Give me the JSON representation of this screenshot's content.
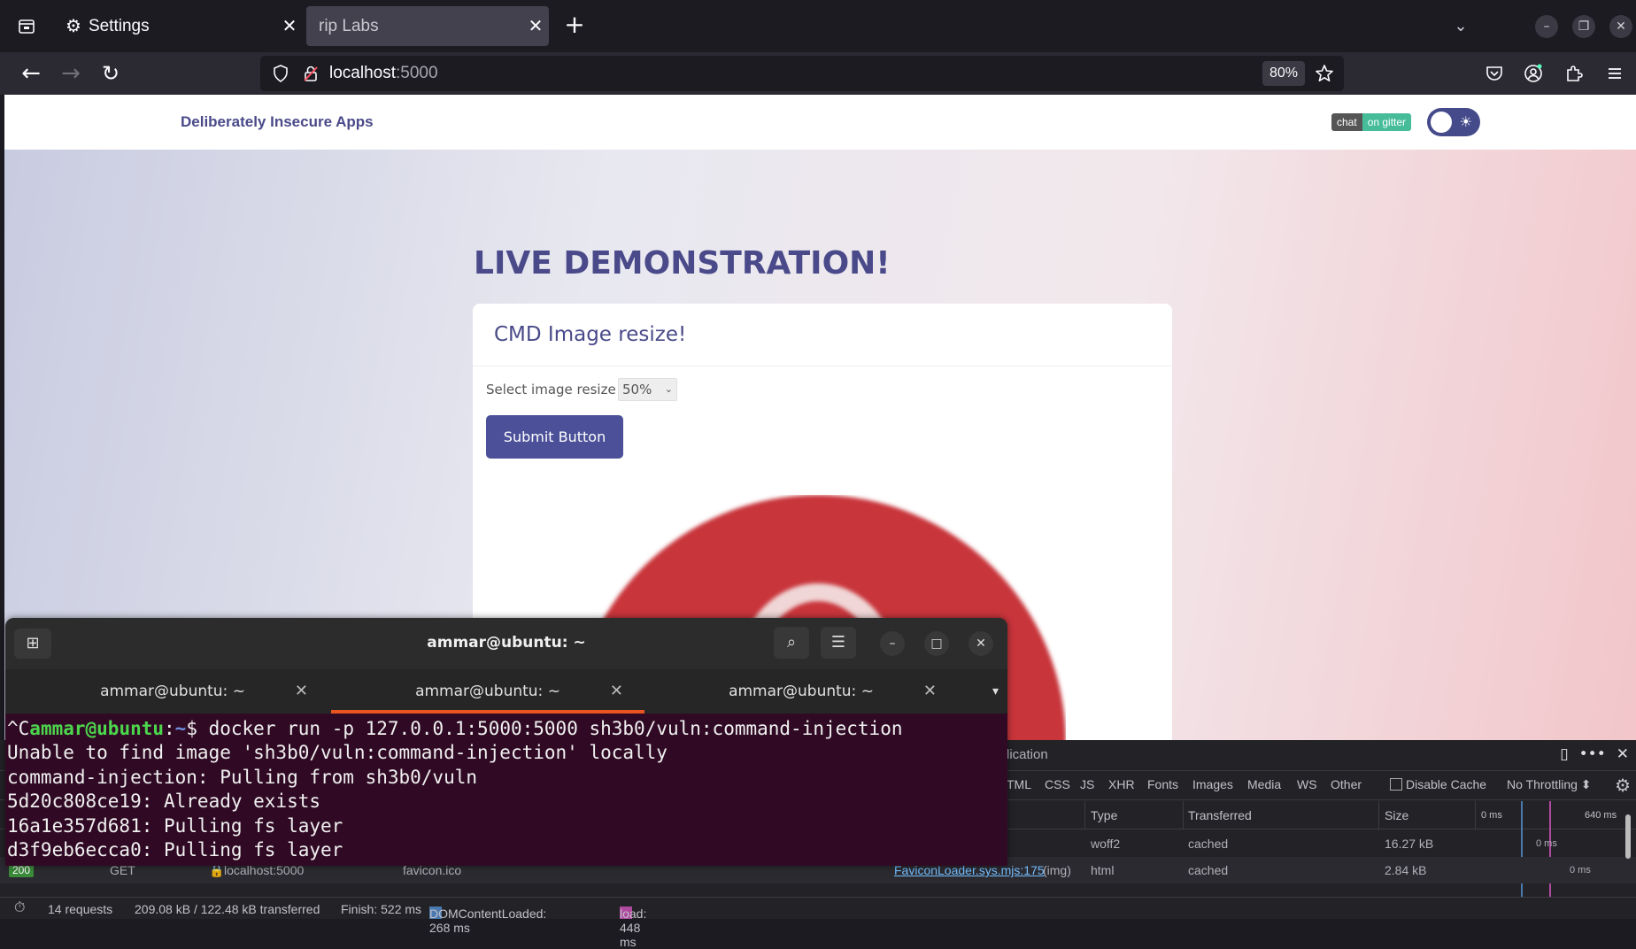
{
  "browser": {
    "tabs": [
      {
        "title": "Settings",
        "icon": "gear-icon"
      },
      {
        "title": "rip Labs",
        "icon": ""
      }
    ],
    "url_host": "localhost",
    "url_port": ":5000",
    "zoom": "80%"
  },
  "site": {
    "brand": "Deliberately Insecure Apps",
    "gitter_left": "chat",
    "gitter_right": "on gitter",
    "hero_title": "LIVE DEMONSTRATION!",
    "card_title": "CMD Image resize!",
    "resize_label": "Select image resize",
    "resize_value": "50%",
    "submit_label": "Submit Button",
    "logo_color": "#c8343a"
  },
  "devtools": {
    "panel_label": "lication",
    "filters": [
      "TML",
      "CSS",
      "JS",
      "XHR",
      "Fonts",
      "Images",
      "Media",
      "WS",
      "Other"
    ],
    "disable_cache": "Disable Cache",
    "throttling": "No Throttling ⬍",
    "columns": [
      "Type",
      "Transferred",
      "Size",
      "0 ms",
      "640 ms"
    ],
    "rows": [
      {
        "status": "",
        "method": "",
        "domain": "",
        "file": "",
        "initiator": "",
        "type": "woff2",
        "transferred": "cached",
        "size": "16.27 kB",
        "time": "0 ms"
      },
      {
        "status": "200",
        "method": "GET",
        "domain": "localhost:5000",
        "file": "favicon.ico",
        "initiator": "FaviconLoader.sys.mjs:175",
        "initiator_suffix": "(img)",
        "type": "html",
        "transferred": "cached",
        "size": "2.84 kB",
        "time": "0 ms"
      }
    ],
    "status": {
      "requests": "14 requests",
      "transferred": "209.08 kB / 122.48 kB transferred",
      "finish": "Finish: 522 ms",
      "dcl": "DOMContentLoaded: 268 ms",
      "load": "load: 448 ms"
    }
  },
  "terminal": {
    "title": "ammar@ubuntu: ~",
    "tabs": [
      "ammar@ubuntu: ~",
      "ammar@ubuntu: ~",
      "ammar@ubuntu: ~"
    ],
    "prompt_prefix": "^C",
    "prompt_user": "ammar@ubuntu",
    "prompt_sep": ":",
    "prompt_path": "~",
    "prompt_command": "$ docker run -p 127.0.0.1:5000:5000 sh3b0/vuln:command-injection",
    "lines": [
      "Unable to find image 'sh3b0/vuln:command-injection' locally",
      "command-injection: Pulling from sh3b0/vuln",
      "5d20c808ce19: Already exists",
      "16a1e357d681: Pulling fs layer",
      "d3f9eb6ecca0: Pulling fs layer"
    ]
  }
}
